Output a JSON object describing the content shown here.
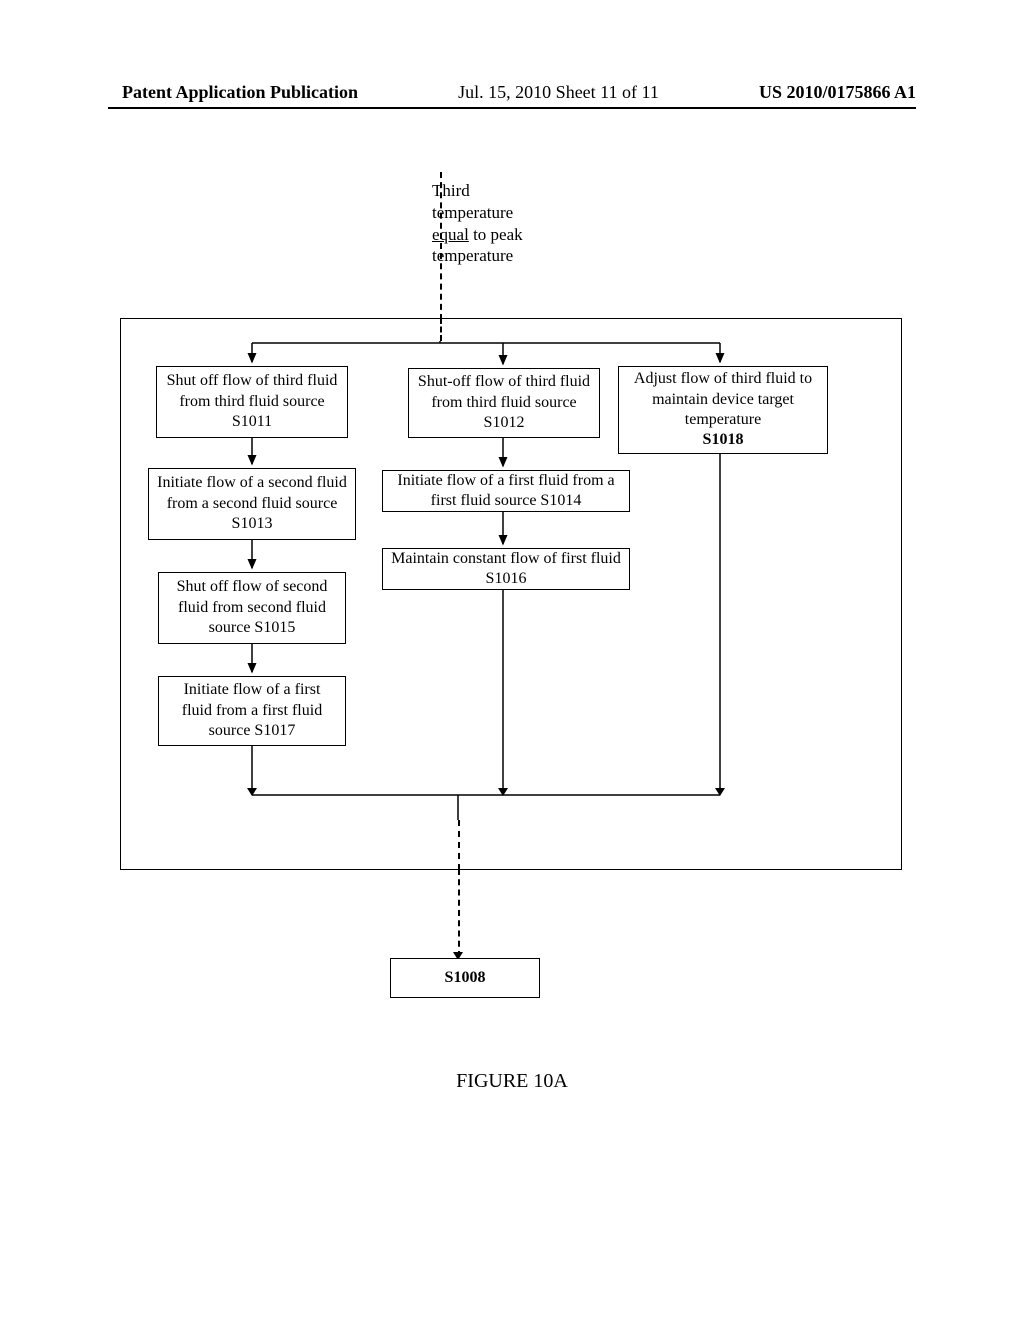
{
  "header": {
    "left": "Patent Application Publication",
    "mid": "Jul. 15, 2010  Sheet 11 of 11",
    "right": "US 2010/0175866 A1"
  },
  "top_label": {
    "line1": "Third",
    "line2": "temperature",
    "line3a": "equal",
    "line3b": " to peak",
    "line4": "temperature"
  },
  "steps": {
    "s1011": "Shut off flow of third fluid from third fluid source S1011",
    "s1012": "Shut-off flow of third fluid from third fluid source S1012",
    "s1018_text": "Adjust flow of third fluid to maintain device target temperature",
    "s1018_id": "S1018",
    "s1013": "Initiate flow of a second fluid from a second fluid source S1013",
    "s1014": "Initiate flow of a first fluid from a first fluid source S1014",
    "s1015": "Shut off flow of second fluid from second fluid source S1015",
    "s1016": "Maintain constant flow of first fluid S1016",
    "s1017": "Initiate flow of a first fluid from a first fluid source S1017",
    "s1008": "S1008"
  },
  "figure_label": "FIGURE 10A"
}
